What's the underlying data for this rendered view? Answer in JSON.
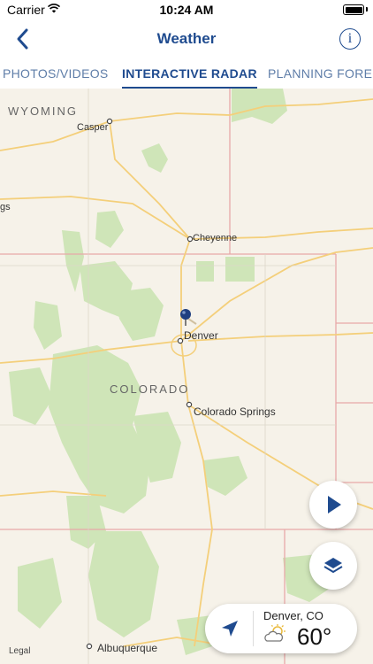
{
  "status": {
    "carrier": "Carrier",
    "time": "10:24 AM"
  },
  "nav": {
    "title": "Weather"
  },
  "tabs": [
    {
      "label": "PHOTOS/VIDEOS",
      "active": false
    },
    {
      "label": "INTERACTIVE RADAR",
      "active": true
    },
    {
      "label": "PLANNING FORECAST",
      "active": false
    }
  ],
  "map": {
    "states": {
      "wyoming": "WYOMING",
      "colorado": "COLORADO"
    },
    "cities": {
      "casper": "Casper",
      "cheyenne": "Cheyenne",
      "denver": "Denver",
      "colorado_springs": "Colorado Springs",
      "albuquerque": "Albuquerque",
      "edge_fragment": "gs"
    },
    "legal": "Legal"
  },
  "weather_panel": {
    "location": "Denver, CO",
    "temperature": "60°"
  },
  "colors": {
    "accent": "#1f4b8f",
    "map_bg": "#f6f2e9",
    "park": "#cfe5b8",
    "road": "#f4cf7a",
    "border": "#e8a9a9"
  },
  "icons": {
    "back": "chevron-left-icon",
    "info": "info-icon",
    "play": "play-icon",
    "layers": "layers-icon",
    "location": "location-arrow-icon",
    "weather": "partly-cloudy-icon"
  }
}
